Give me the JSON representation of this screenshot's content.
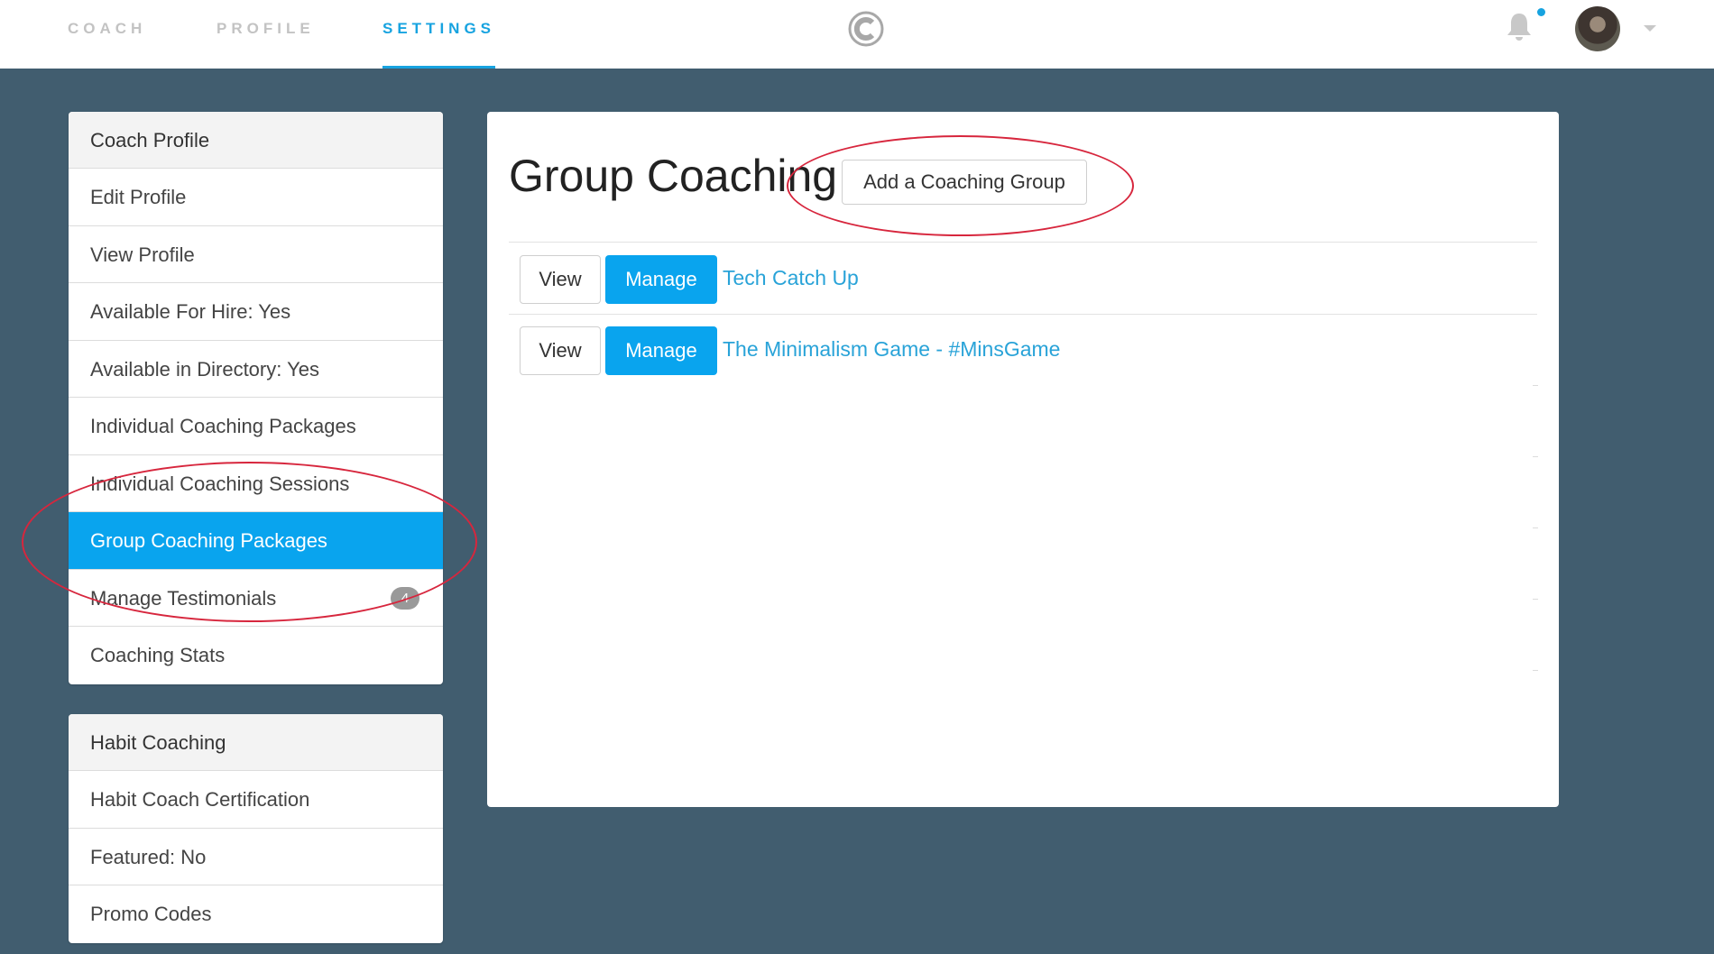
{
  "topnav": {
    "tabs": [
      {
        "label": "COACH",
        "active": false
      },
      {
        "label": "PROFILE",
        "active": false
      },
      {
        "label": "SETTINGS",
        "active": true
      }
    ],
    "logo_icon": "circle-c-logo-icon",
    "has_notification": true,
    "accent_color": "#17a3e0"
  },
  "sidebar": {
    "coach_profile": {
      "heading": "Coach Profile",
      "items": [
        {
          "label": "Edit Profile"
        },
        {
          "label": "View Profile"
        },
        {
          "label": "Available For Hire: Yes"
        },
        {
          "label": "Available in Directory: Yes"
        },
        {
          "label": "Individual Coaching Packages"
        },
        {
          "label": "Individual Coaching Sessions"
        },
        {
          "label": "Group Coaching Packages",
          "active": true
        },
        {
          "label": "Manage Testimonials",
          "badge": "4"
        },
        {
          "label": "Coaching Stats"
        }
      ]
    },
    "habit_coaching": {
      "heading": "Habit Coaching",
      "items": [
        {
          "label": "Habit Coach Certification"
        },
        {
          "label": "Featured: No"
        },
        {
          "label": "Promo Codes"
        }
      ]
    }
  },
  "main": {
    "title": "Group Coaching",
    "add_button_label": "Add a Coaching Group",
    "groups": [
      {
        "view_label": "View",
        "manage_label": "Manage",
        "name": "Tech Catch Up"
      },
      {
        "view_label": "View",
        "manage_label": "Manage",
        "name": "The Minimalism Game - #MinsGame"
      }
    ]
  },
  "colors": {
    "background": "#415d6f",
    "primary": "#09a4ee",
    "link": "#29a3d8",
    "annotation": "#d7263d"
  }
}
